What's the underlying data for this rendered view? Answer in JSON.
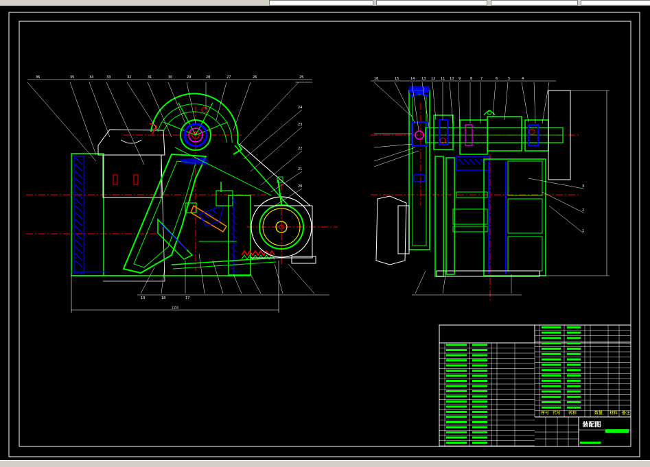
{
  "toolbar": {
    "fields": [
      "",
      "",
      ""
    ],
    "icon_names": [
      "back-icon",
      "forward-icon",
      "zoom-icon",
      "search-icon"
    ]
  },
  "drawing": {
    "title_block": {
      "title": "装配图",
      "headers": [
        "序号",
        "代号",
        "名称",
        "数量",
        "材料",
        "备注"
      ]
    },
    "dimensions": {
      "overall_length": "1550"
    },
    "front_view_callouts": [
      "36",
      "35",
      "34",
      "33",
      "32",
      "31",
      "30",
      "29",
      "28",
      "27",
      "26",
      "25",
      "24",
      "23",
      "22",
      "21",
      "20",
      "19",
      "18",
      "17"
    ],
    "side_view_callouts": [
      "16",
      "15",
      "14",
      "13",
      "12",
      "11",
      "10",
      "9",
      "8",
      "7",
      "6",
      "5",
      "4",
      "3",
      "2",
      "1"
    ],
    "colors": {
      "outline": "#00ff00",
      "centerline": "#ff0000",
      "hatch": "#0000ff",
      "leader": "#ffffff",
      "accent": "#ffff00",
      "highlight": "#ff00ff"
    }
  }
}
